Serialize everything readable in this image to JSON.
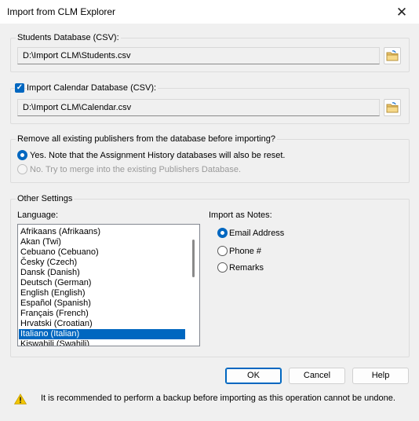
{
  "window": {
    "title": "Import from CLM Explorer",
    "close_glyph": "✕"
  },
  "students_db": {
    "label": "Students Database (CSV):",
    "path": "D:\\Import CLM\\Students.csv"
  },
  "calendar_db": {
    "label": "Import Calendar Database (CSV):",
    "checked": true,
    "path": "D:\\Import CLM\\Calendar.csv"
  },
  "remove_publishers": {
    "label": "Remove all existing publishers from the database before importing?",
    "option_yes": "Yes. Note that the Assignment History databases will also be reset.",
    "option_no": "No. Try to merge into the existing Publishers Database.",
    "selected": "yes"
  },
  "other_settings": {
    "label": "Other Settings",
    "language_label": "Language:",
    "languages": [
      "Afrikaans (Afrikaans)",
      "Akan (Twi)",
      "Cebuano (Cebuano)",
      "Česky (Czech)",
      "Dansk (Danish)",
      "Deutsch (German)",
      "English (English)",
      "Español (Spanish)",
      "Français (French)",
      "Hrvatski (Croatian)",
      "Italiano (Italian)",
      "Kiswahili (Swahili)"
    ],
    "selected_language": "Italiano (Italian)",
    "notes_label": "Import as Notes:",
    "notes_options": [
      "Email Address",
      "Phone #",
      "Remarks"
    ],
    "notes_selected": "Email Address"
  },
  "buttons": {
    "ok": "OK",
    "cancel": "Cancel",
    "help": "Help"
  },
  "warning": {
    "icon": "warning-icon",
    "text": "It is recommended to perform a backup before importing as this operation cannot be undone."
  },
  "colors": {
    "accent": "#0067c0",
    "warning": "#f2c500"
  }
}
